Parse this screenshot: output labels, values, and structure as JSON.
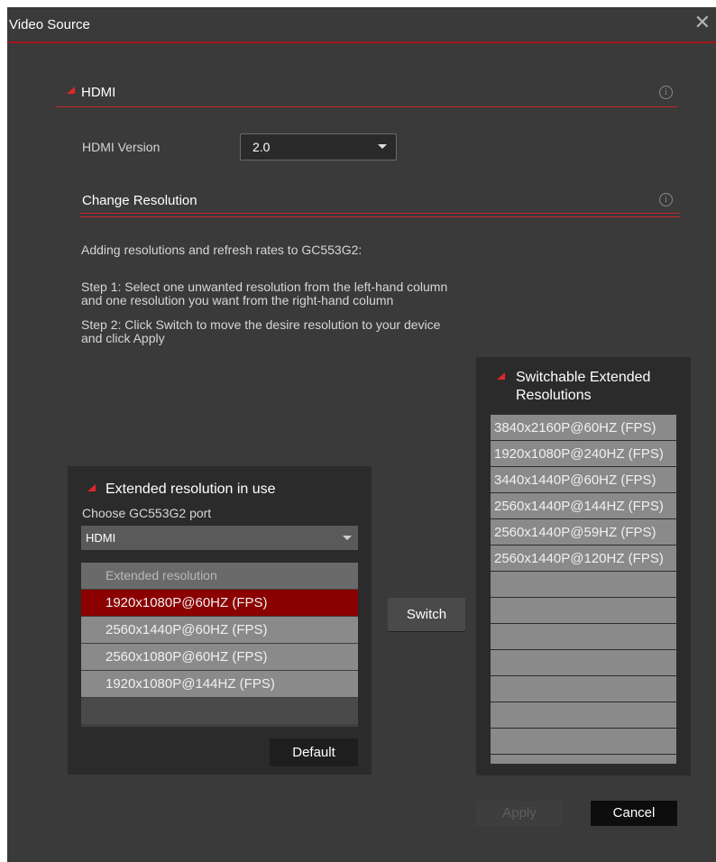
{
  "window": {
    "title": "Video Source",
    "close_icon": "close-icon"
  },
  "hdmi_section": {
    "label": "HDMI",
    "version_label": "HDMI Version",
    "version_value": "2.0"
  },
  "change_resolution": {
    "label": "Change Resolution",
    "intro": "Adding resolutions and refresh rates to GC553G2:",
    "step1_line1": "Step 1: Select one unwanted resolution from the left-hand column",
    "step1_line2": "and one resolution you want from the right-hand column",
    "step2_line1": "Step 2: Click Switch to move the desire resolution to your device",
    "step2_line2": "and click Apply"
  },
  "in_use_panel": {
    "title": "Extended resolution in use",
    "port_label": "Choose GC553G2 port",
    "port_value": "HDMI",
    "column_header": "Extended resolution",
    "items": [
      "1920x1080P@60HZ (FPS)",
      "2560x1440P@60HZ (FPS)",
      "2560x1080P@60HZ (FPS)",
      "1920x1080P@144HZ (FPS)"
    ],
    "selected_index": 0,
    "default_label": "Default"
  },
  "switch_label": "Switch",
  "switchable_panel": {
    "title_line1": "Switchable Extended",
    "title_line2": "Resolutions",
    "items": [
      "3840x2160P@60HZ (FPS)",
      "1920x1080P@240HZ (FPS)",
      "3440x1440P@60HZ (FPS)",
      "2560x1440P@144HZ (FPS)",
      "2560x1440P@59HZ (FPS)",
      "2560x1440P@120HZ (FPS)"
    ]
  },
  "footer": {
    "apply_label": "Apply",
    "cancel_label": "Cancel"
  },
  "colors": {
    "accent_red": "#c5252a",
    "selected_row": "#8b0000",
    "background": "#3a3a3a"
  }
}
